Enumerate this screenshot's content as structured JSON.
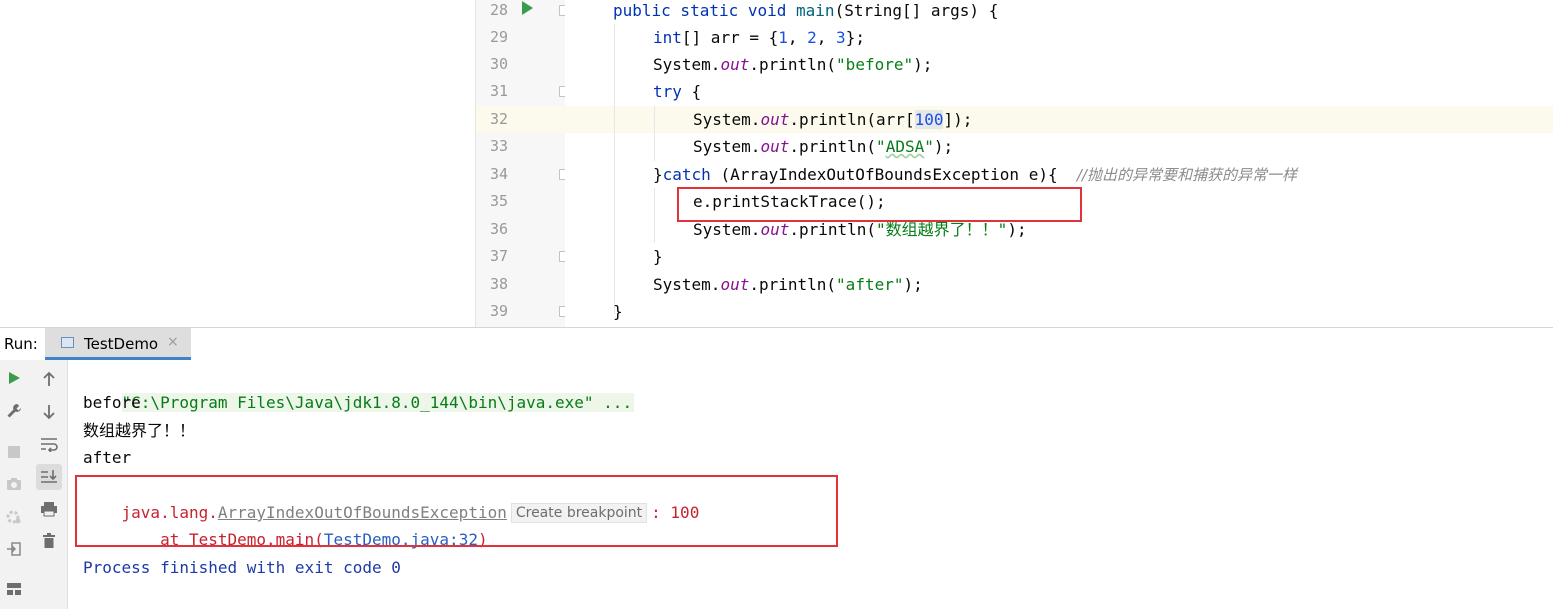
{
  "editor": {
    "lines": [
      {
        "n": "28",
        "text": "public static void main(String[] args) {"
      },
      {
        "n": "29",
        "text": "int[] arr = {1, 2, 3};"
      },
      {
        "n": "30",
        "text": "System.out.println(\"before\");"
      },
      {
        "n": "31",
        "text": "try {"
      },
      {
        "n": "32",
        "text": "System.out.println(arr[100]);"
      },
      {
        "n": "33",
        "text": "System.out.println(\"ADSA\");"
      },
      {
        "n": "34",
        "text": "}catch (ArrayIndexOutOfBoundsException e){"
      },
      {
        "n": "35",
        "text": "e.printStackTrace();"
      },
      {
        "n": "36",
        "text": "System.out.println(\"数组越界了！！\");"
      },
      {
        "n": "37",
        "text": "}"
      },
      {
        "n": "38",
        "text": "System.out.println(\"after\");"
      },
      {
        "n": "39",
        "text": "}"
      }
    ],
    "comment_34": "//抛出的异常要和捕获的异常一样"
  },
  "run_panel": {
    "label": "Run:",
    "tab_title": "TestDemo",
    "tab_close": "×"
  },
  "console": {
    "cmd": "\"C:\\Program Files\\Java\\jdk1.8.0_144\\bin\\java.exe\" ...",
    "out1": "before",
    "out2": "数组越界了！！",
    "out3": "after",
    "exc_pkg": "java.lang.",
    "exc_class": "ArrayIndexOutOfBoundsException",
    "bp_hint": "Create breakpoint",
    "exc_msg": ": 100",
    "stack_prefix": "    at TestDemo.main(",
    "stack_link": "TestDemo.java:32",
    "stack_suffix": ")",
    "finish": "Process finished with exit code 0"
  },
  "icons": {
    "run": "run-icon",
    "wrench": "wrench-icon",
    "stop": "stop-icon",
    "camera": "camera-icon",
    "settings": "settings-icon",
    "login": "login-icon",
    "layout": "layout-icon",
    "up": "arrow-up-icon",
    "down": "arrow-down-icon",
    "wrap": "soft-wrap-icon",
    "scroll": "scroll-to-end-icon",
    "print": "print-icon",
    "trash": "trash-icon"
  },
  "colors": {
    "keyword": "#0033b3",
    "number": "#1750eb",
    "string": "#067d17",
    "field": "#871094",
    "error": "#c7222d",
    "highlight_box": "#e0333a",
    "tab_accent": "#4083c9"
  }
}
